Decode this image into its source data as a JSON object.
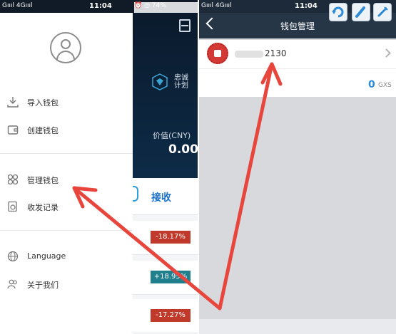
{
  "left_phone": {
    "status": {
      "signal": "Gıııl 4Gıııl",
      "time": "11:04",
      "right": "⏰ ◎ 74%"
    },
    "drawer": {
      "items": [
        {
          "label": "导入钱包",
          "icon": "download-icon"
        },
        {
          "label": "创建钱包",
          "icon": "wallet-icon"
        },
        {
          "label": "管理钱包",
          "icon": "grid-icon"
        },
        {
          "label": "收发记录",
          "icon": "records-icon"
        },
        {
          "label": "Language",
          "icon": "globe-icon"
        },
        {
          "label": "关于我们",
          "icon": "users-icon"
        }
      ]
    },
    "main": {
      "badge_text": "忠诚\n计划",
      "price_label": "价值(CNY)",
      "price_value": "0.00",
      "receive_label": "接收",
      "changes": [
        {
          "value": "-18.17%",
          "color": "#c0392b"
        },
        {
          "value": "+18.95%",
          "color": "#1f7f8c"
        },
        {
          "value": "-17.27%",
          "color": "#c0392b"
        }
      ]
    }
  },
  "right_phone": {
    "status": {
      "signal": "Gıııl 4Gıııl",
      "time": "11:04"
    },
    "title": "钱包管理",
    "wallet": {
      "name_suffix": "2130",
      "balance": "0",
      "unit": "GXS"
    }
  },
  "colors": {
    "arrow": "#e8453c",
    "accent_blue": "#2e8bd8",
    "header_dark": "#263647"
  }
}
